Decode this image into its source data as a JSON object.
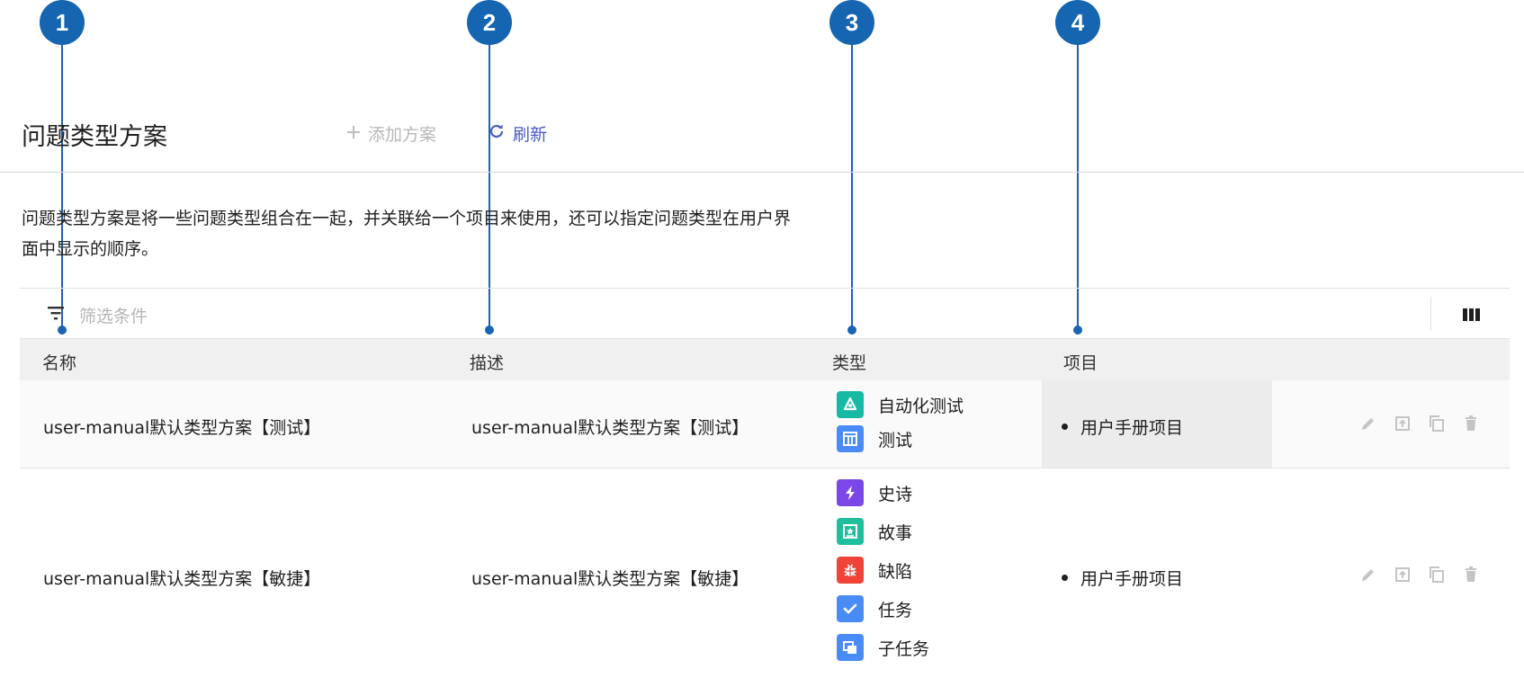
{
  "callouts": [
    "1",
    "2",
    "3",
    "4"
  ],
  "header": {
    "title": "问题类型方案",
    "add_label": "添加方案",
    "refresh_label": "刷新"
  },
  "description": "问题类型方案是将一些问题类型组合在一起，并关联给一个项目来使用，还可以指定问题类型在用户界面中显示的顺序。",
  "filter": {
    "placeholder": "筛选条件"
  },
  "table": {
    "columns": [
      "名称",
      "描述",
      "类型",
      "项目"
    ],
    "rows": [
      {
        "name": "user-manual默认类型方案【测试】",
        "description": "user-manual默认类型方案【测试】",
        "types": [
          {
            "label": "自动化测试",
            "icon": "automation-test-icon",
            "color": "#16b9a3"
          },
          {
            "label": "测试",
            "icon": "test-icon",
            "color": "#4a8cf7"
          }
        ],
        "project": "用户手册项目"
      },
      {
        "name": "user-manual默认类型方案【敏捷】",
        "description": "user-manual默认类型方案【敏捷】",
        "types": [
          {
            "label": "史诗",
            "icon": "epic-icon",
            "color": "#7b47e8"
          },
          {
            "label": "故事",
            "icon": "story-icon",
            "color": "#1fbf9d"
          },
          {
            "label": "缺陷",
            "icon": "bug-icon",
            "color": "#f04438"
          },
          {
            "label": "任务",
            "icon": "task-icon",
            "color": "#4a8cf7"
          },
          {
            "label": "子任务",
            "icon": "subtask-icon",
            "color": "#4a8cf7"
          }
        ],
        "project": "用户手册项目"
      }
    ]
  },
  "row_actions": [
    "edit-icon",
    "publish-icon",
    "copy-icon",
    "delete-icon"
  ],
  "colors": {
    "callout": "#1565b0",
    "refresh_accent": "#4a5bc4",
    "disabled_text": "#b8b8b8"
  }
}
